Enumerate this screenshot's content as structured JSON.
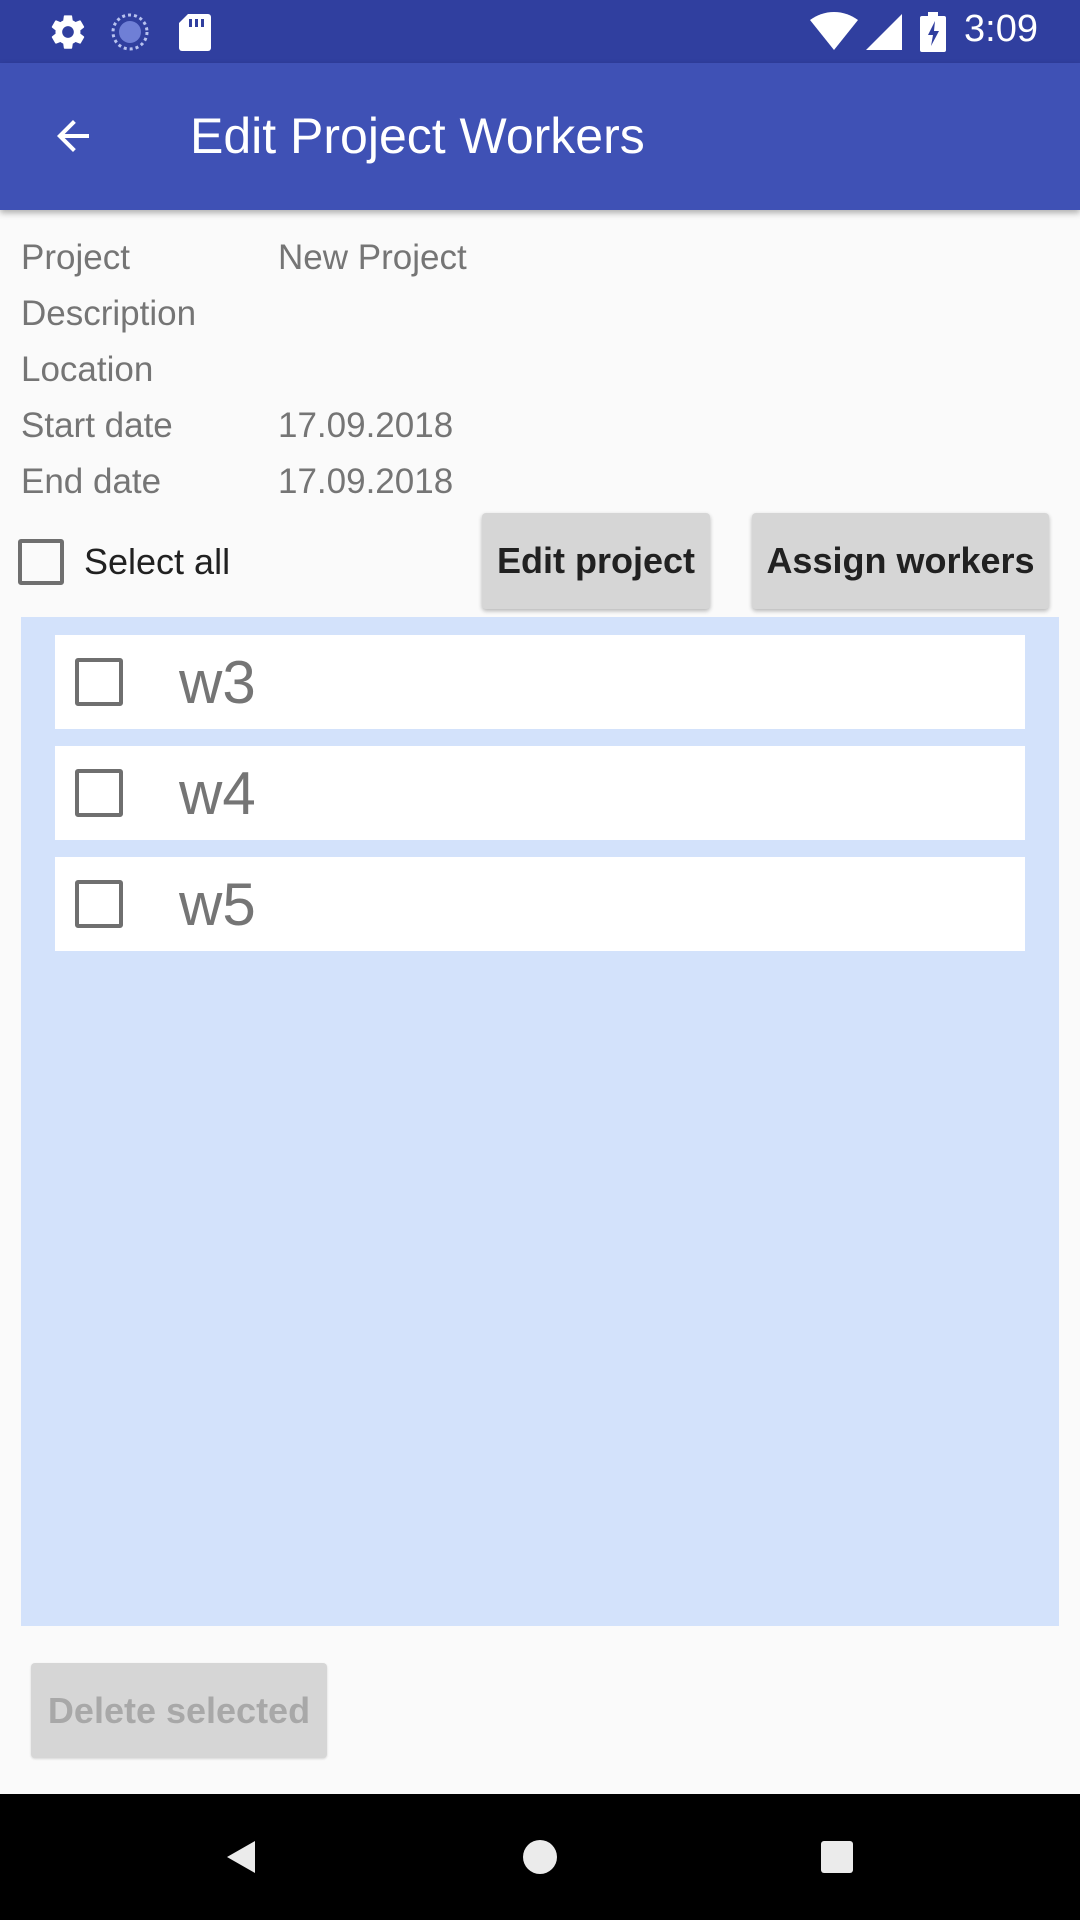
{
  "status_bar": {
    "time": "3:09",
    "icons": [
      "gear-icon",
      "loading-circle-icon",
      "sd-card-icon",
      "wifi-icon",
      "signal-icon",
      "battery-charging-icon"
    ],
    "color": "#303f9f"
  },
  "app_bar": {
    "title": "Edit Project Workers",
    "back_icon": "arrow-back-icon",
    "color": "#3f51b5"
  },
  "project_info": [
    {
      "label": "Project",
      "value": "New Project"
    },
    {
      "label": "Description",
      "value": ""
    },
    {
      "label": "Location",
      "value": ""
    },
    {
      "label": "Start date",
      "value": "17.09.2018"
    },
    {
      "label": "End date",
      "value": "17.09.2018"
    }
  ],
  "actions": {
    "select_all_label": "Select all",
    "select_all_checked": false,
    "edit_project_label": "Edit project",
    "assign_workers_label": "Assign workers",
    "delete_selected_label": "Delete selected"
  },
  "workers": [
    {
      "name": "w3",
      "checked": false
    },
    {
      "name": "w4",
      "checked": false
    },
    {
      "name": "w5",
      "checked": false
    }
  ],
  "colors": {
    "list_background": "#d3e2fb",
    "button_background": "#d6d6d6",
    "disabled_text": "#a8a8a8"
  },
  "nav_bar": {
    "icons": [
      "back-triangle-icon",
      "home-circle-icon",
      "recents-square-icon"
    ]
  }
}
